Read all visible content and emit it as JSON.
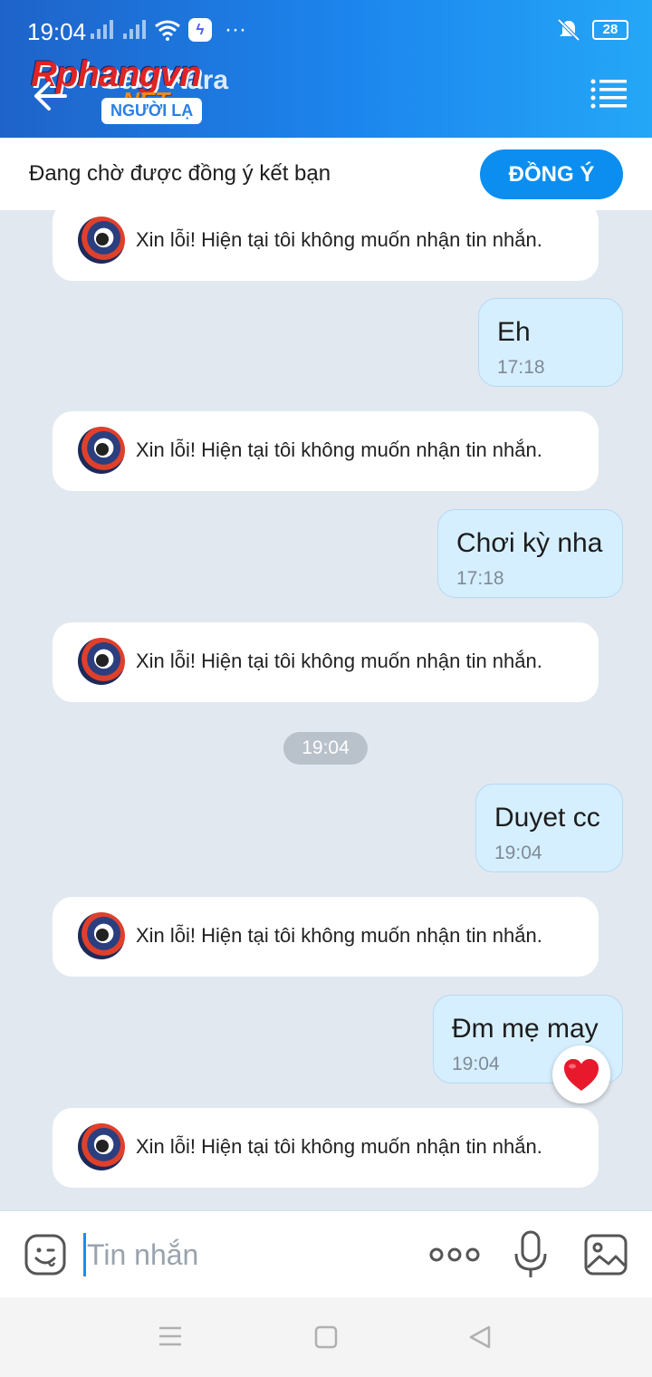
{
  "status": {
    "time": "19:04",
    "battery": "28"
  },
  "header": {
    "contact_name": "Cam Kara",
    "badge": "NGƯỜI LẠ",
    "watermark": "Rphangvn",
    "watermark_suffix": ".NET"
  },
  "pending": {
    "text": "Đang chờ được đồng ý kết bạn",
    "accept_label": "ĐỒNG Ý"
  },
  "messages": [
    {
      "type": "system",
      "text": "Xin lỗi! Hiện tại tôi không muốn nhận tin nhắn."
    },
    {
      "type": "outgoing",
      "text": "Eh",
      "time": "17:18"
    },
    {
      "type": "system",
      "text": "Xin lỗi! Hiện tại tôi không muốn nhận tin nhắn."
    },
    {
      "type": "outgoing",
      "text": "Chơi kỳ nha",
      "time": "17:18"
    },
    {
      "type": "system",
      "text": "Xin lỗi! Hiện tại tôi không muốn nhận tin nhắn."
    },
    {
      "type": "date",
      "text": "19:04"
    },
    {
      "type": "outgoing",
      "text": "Duyet cc",
      "time": "19:04"
    },
    {
      "type": "system",
      "text": "Xin lỗi! Hiện tại tôi không muốn nhận tin nhắn."
    },
    {
      "type": "outgoing",
      "text": "Đm mẹ may",
      "time": "19:04",
      "reaction": "heart"
    },
    {
      "type": "system",
      "text": "Xin lỗi! Hiện tại tôi không muốn nhận tin nhắn."
    }
  ],
  "composer": {
    "placeholder": "Tin nhắn"
  },
  "colors": {
    "accent": "#0b8ef0",
    "outgoing_bubble": "#d6efff",
    "chat_bg": "#e2e8f0",
    "heart": "#e8192c"
  }
}
